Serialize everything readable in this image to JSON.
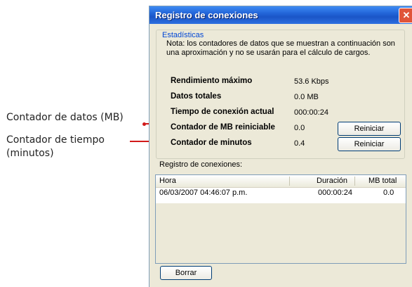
{
  "callouts": {
    "data_counter": "Contador de datos (MB)",
    "time_counter_line1": "Contador de tiempo",
    "time_counter_line2": "(minutos)"
  },
  "window": {
    "title": "Registro de conexiones",
    "close_icon": "close-icon"
  },
  "stats": {
    "group_title": "Estadísticas",
    "note": "Nota: los contadores de datos que se muestran a continuación son una aproximación y no se usarán para el cálculo de cargos.",
    "rows": [
      {
        "label": "Rendimiento máximo",
        "value": "53.6 Kbps"
      },
      {
        "label": "Datos totales",
        "value": "0.0 MB"
      },
      {
        "label": "Tiempo de conexión actual",
        "value": "000:00:24"
      },
      {
        "label": "Contador de MB reiniciable",
        "value": "0.0"
      },
      {
        "label": "Contador de minutos",
        "value": "0.4"
      }
    ],
    "reset_label": "Reiniciar"
  },
  "log": {
    "label": "Registro de conexiones:",
    "columns": [
      "Hora",
      "Duración",
      "MB total"
    ],
    "rows": [
      {
        "hora": "06/03/2007 04:46:07 p.m.",
        "duracion": "000:00:24",
        "mb": "0.0"
      }
    ],
    "delete_label": "Borrar"
  },
  "colors": {
    "accent": "#0046d5",
    "callout_line": "#d11a1a",
    "titlebar": "#2264d8"
  }
}
